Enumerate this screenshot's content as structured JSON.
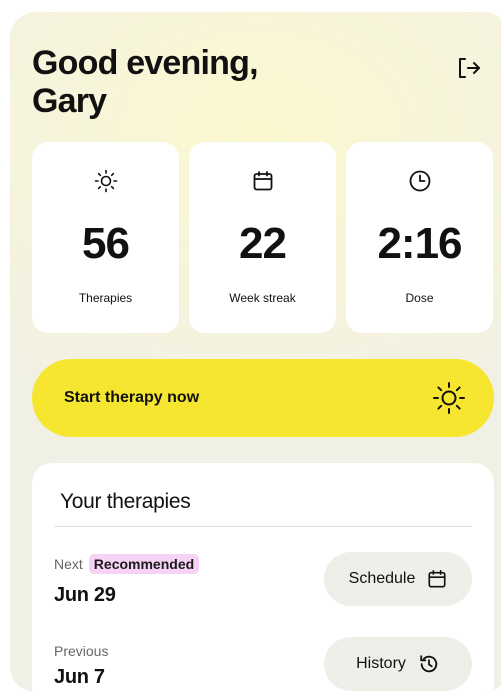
{
  "greeting": {
    "line1": "Good evening,",
    "line2": "Gary"
  },
  "header": {
    "logout_icon": "logout-icon"
  },
  "stats": [
    {
      "icon": "sun-icon",
      "value": "56",
      "label": "Therapies"
    },
    {
      "icon": "calendar-icon",
      "value": "22",
      "label": "Week streak"
    },
    {
      "icon": "clock-icon",
      "value": "2:16",
      "label": "Dose"
    }
  ],
  "cta": {
    "label": "Start therapy now",
    "icon": "sun-icon"
  },
  "therapies": {
    "title": "Your therapies",
    "next": {
      "label": "Next",
      "badge": "Recommended",
      "date": "Jun 29",
      "button_label": "Schedule",
      "button_icon": "calendar-icon"
    },
    "previous": {
      "label": "Previous",
      "date": "Jun 7",
      "button_label": "History",
      "button_icon": "history-icon"
    }
  },
  "colors": {
    "accent_yellow": "#f7e62f",
    "badge_pink": "#f6d3f4",
    "background": "#f6f4dc"
  }
}
